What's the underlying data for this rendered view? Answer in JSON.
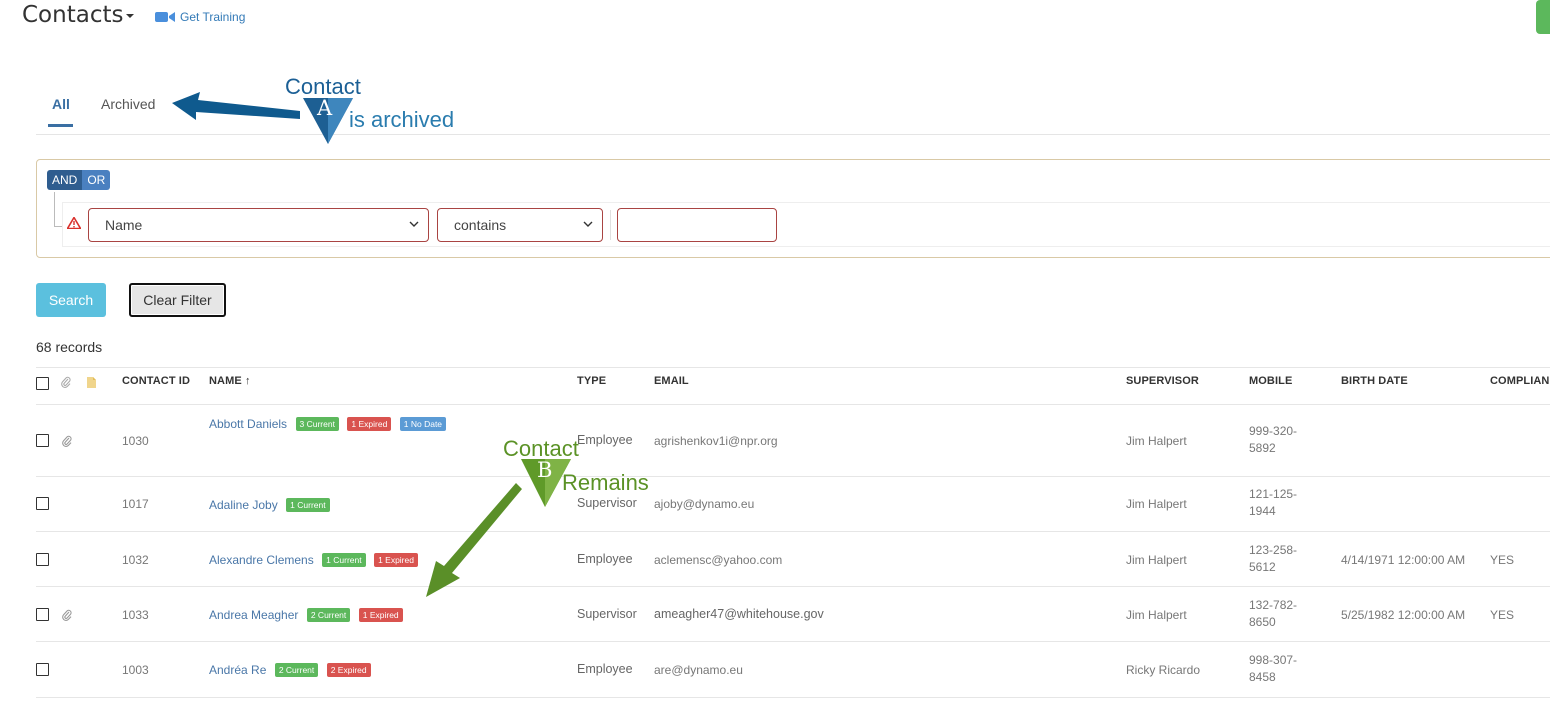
{
  "header": {
    "title": "Contacts",
    "training_label": "Get Training"
  },
  "tabs": [
    {
      "label": "All",
      "active": true
    },
    {
      "label": "Archived",
      "active": false
    }
  ],
  "filter": {
    "logic_and": "AND",
    "logic_or": "OR",
    "field_value": "Name",
    "operator_value": "contains",
    "value_text": ""
  },
  "buttons": {
    "search": "Search",
    "clear": "Clear Filter"
  },
  "records_label": "68 records",
  "table": {
    "headers": [
      "CONTACT ID",
      "NAME ↑",
      "TYPE",
      "EMAIL",
      "SUPERVISOR",
      "MOBILE",
      "BIRTH DATE",
      "COMPLIAN"
    ],
    "rows": [
      {
        "id": "1030",
        "name": "Abbott Daniels",
        "badges": [
          "3 Current",
          "1 Expired",
          "1 No Date"
        ],
        "type": "Employee",
        "email": "agrishenkov1i@npr.org",
        "supervisor": "Jim Halpert",
        "mobile_1": "999-320-",
        "mobile_2": "5892",
        "birth": "",
        "compliant": "",
        "attachment": true
      },
      {
        "id": "1017",
        "name": "Adaline Joby",
        "badges": [
          "1 Current"
        ],
        "type": "Supervisor",
        "email": "ajoby@dynamo.eu",
        "supervisor": "Jim Halpert",
        "mobile_1": "121-125-",
        "mobile_2": "1944",
        "birth": "",
        "compliant": "",
        "attachment": false
      },
      {
        "id": "1032",
        "name": "Alexandre Clemens",
        "badges": [
          "1 Current",
          "1 Expired"
        ],
        "type": "Employee",
        "email": "aclemensc@yahoo.com",
        "supervisor": "Jim Halpert",
        "mobile_1": "123-258-",
        "mobile_2": "5612",
        "birth": "4/14/1971 12:00:00 AM",
        "compliant": "YES",
        "attachment": false
      },
      {
        "id": "1033",
        "name": "Andrea Meagher",
        "badges": [
          "2 Current",
          "1 Expired"
        ],
        "type": "Supervisor",
        "email": "ameagher47@whitehouse.gov",
        "supervisor": "Jim Halpert",
        "mobile_1": "132-782-",
        "mobile_2": "8650",
        "birth": "5/25/1982 12:00:00 AM",
        "compliant": "YES",
        "attachment": true
      },
      {
        "id": "1003",
        "name": "Andréa Re",
        "badges": [
          "2 Current",
          "2 Expired"
        ],
        "type": "Employee",
        "email": "are@dynamo.eu",
        "supervisor": "Ricky Ricardo",
        "mobile_1": "998-307-",
        "mobile_2": "8458",
        "birth": "",
        "compliant": "",
        "attachment": false
      }
    ]
  },
  "annotations": {
    "a_line1": "Contact",
    "a_letter": "A",
    "a_line2": "is archived",
    "b_line1": "Contact",
    "b_letter": "B",
    "b_line2": "Remains"
  },
  "colors": {
    "accent": "#3a6fa3",
    "search_button": "#5bc0de",
    "badge_current": "#5cb85c",
    "badge_expired": "#d9534f",
    "badge_nodate": "#5b9bd5",
    "annotation_blue": "#1b5f95",
    "annotation_green": "#5b9226"
  },
  "icons": [
    "chevron-down-icon",
    "video-camera-icon",
    "warning-icon",
    "paperclip-icon",
    "note-icon",
    "checkbox-icon",
    "arrow-up-icon"
  ]
}
